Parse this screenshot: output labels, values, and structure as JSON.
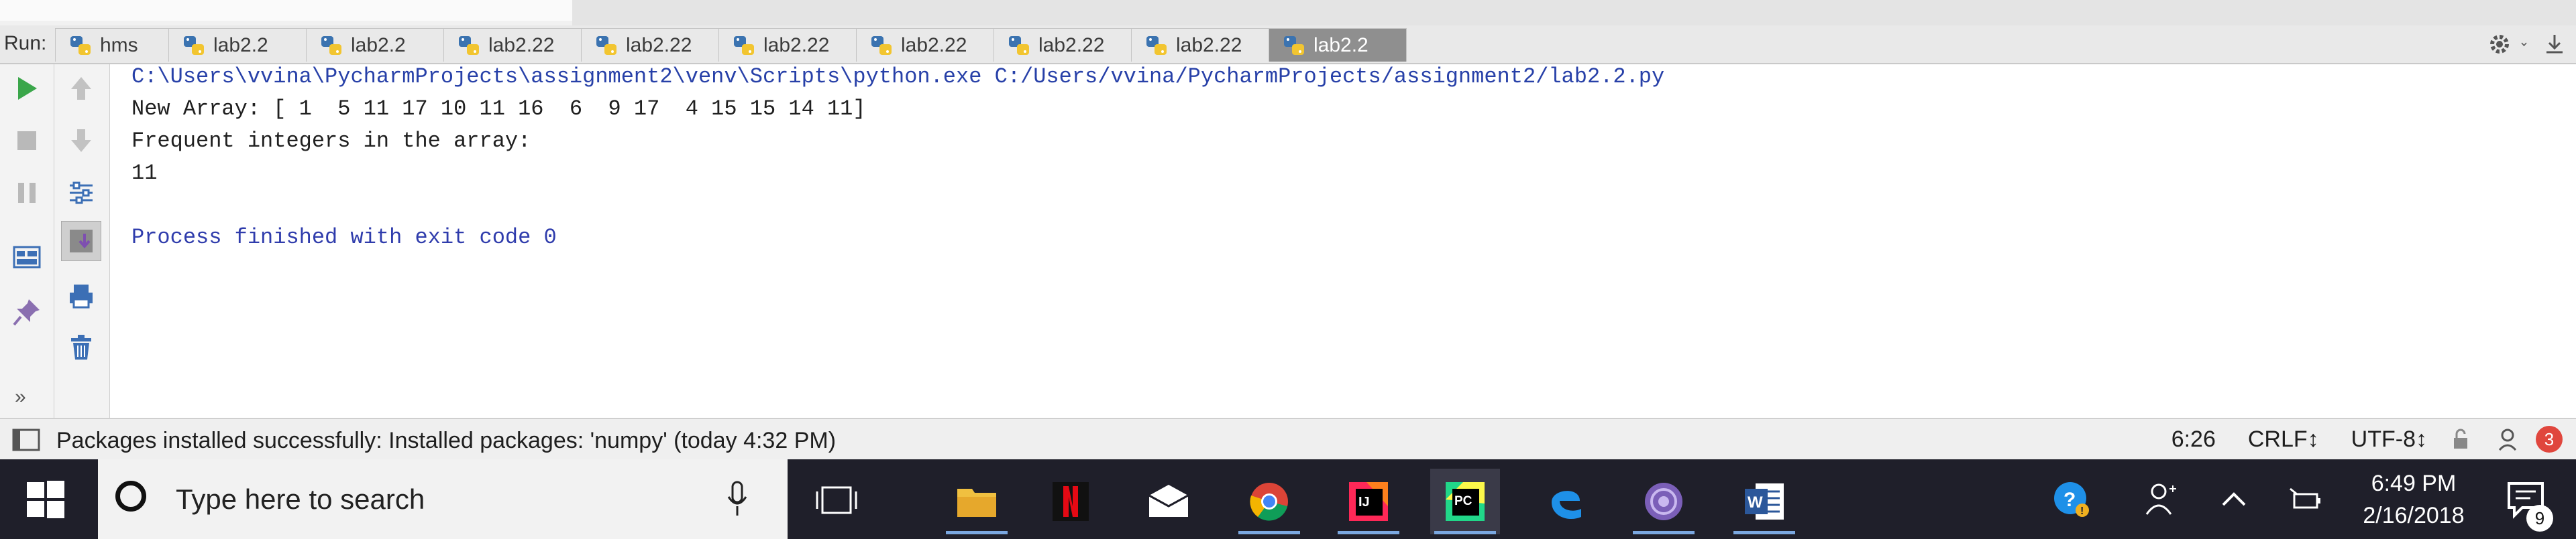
{
  "run_bar": {
    "label": "Run:",
    "tabs": [
      {
        "label": "hms"
      },
      {
        "label": "lab2.2"
      },
      {
        "label": "lab2.2"
      },
      {
        "label": "lab2.22"
      },
      {
        "label": "lab2.22"
      },
      {
        "label": "lab2.22"
      },
      {
        "label": "lab2.22"
      },
      {
        "label": "lab2.22"
      },
      {
        "label": "lab2.22"
      },
      {
        "label": "lab2.2",
        "active": true
      }
    ]
  },
  "console": {
    "lines": [
      "C:\\Users\\vvina\\PycharmProjects\\assignment2\\venv\\Scripts\\python.exe C:/Users/vvina/PycharmProjects/assignment2/lab2.2.py",
      "New Array: [ 1  5 11 17 10 11 16  6  9 17  4 15 15 14 11]",
      "Frequent integers in the array:",
      "11",
      "Process finished with exit code 0"
    ]
  },
  "status_bar": {
    "message": "Packages installed successfully: Installed packages: 'numpy' (today 4:32 PM)",
    "position": "6:26",
    "line_separator": "CRLF↕",
    "encoding": "UTF-8↕",
    "event_count": "3"
  },
  "taskbar": {
    "search_placeholder": "Type here to search",
    "clock_time": "6:49 PM",
    "clock_date": "2/16/2018",
    "notification_count": "9"
  },
  "colors": {
    "console_path": "#2740a8",
    "console_exit": "#2f3cac",
    "active_tab": "#8f8f8f",
    "taskbar": "#1f1f2a"
  }
}
